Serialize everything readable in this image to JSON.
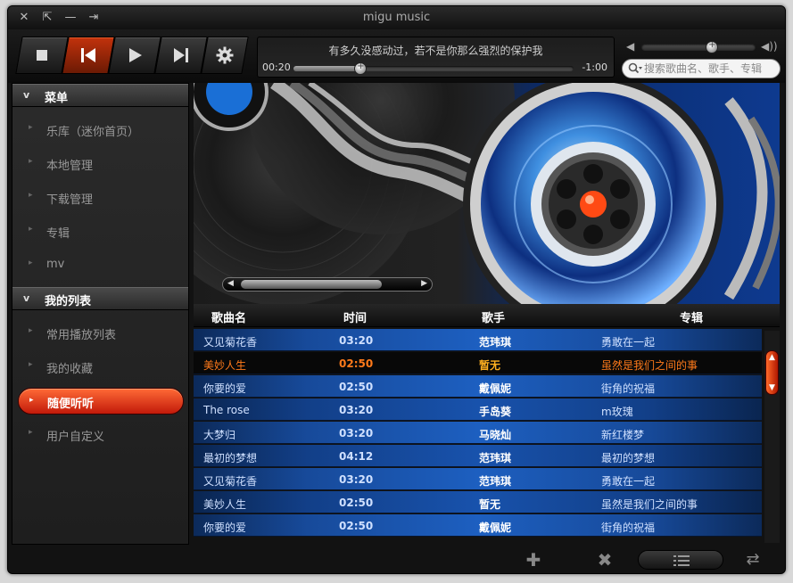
{
  "window": {
    "title": "migu music"
  },
  "player": {
    "now_playing": "有多久没感动过，若不是你那么强烈的保护我",
    "current_time": "00:20",
    "remaining_time": "-1:00",
    "progress": 0.24,
    "volume": 0.62
  },
  "search": {
    "placeholder": "搜索歌曲名、歌手、专辑"
  },
  "sidebar": {
    "menu_header": "菜单",
    "menu_items": [
      {
        "label": "乐库（迷你首页）"
      },
      {
        "label": "本地管理"
      },
      {
        "label": "下载管理"
      },
      {
        "label": "专辑"
      },
      {
        "label": "mv"
      }
    ],
    "list_header": "我的列表",
    "list_items": [
      {
        "label": "常用播放列表"
      },
      {
        "label": "我的收藏"
      },
      {
        "label": "随便听听",
        "active": true
      },
      {
        "label": "用户自定义"
      }
    ]
  },
  "table": {
    "headers": {
      "title": "歌曲名",
      "time": "时间",
      "artist": "歌手",
      "album": "专辑"
    },
    "rows": [
      {
        "title": "又见菊花香",
        "time": "03:20",
        "artist": "范玮琪",
        "album": "勇敢在一起"
      },
      {
        "title": "美妙人生",
        "time": "02:50",
        "artist": "暂无",
        "album": "虽然是我们之间的事",
        "playing": true
      },
      {
        "title": "你要的爱",
        "time": "02:50",
        "artist": "戴佩妮",
        "album": "街角的祝福"
      },
      {
        "title": "The rose",
        "time": "03:20",
        "artist": "手岛葵",
        "album": "m玫瑰"
      },
      {
        "title": "大梦归",
        "time": "03:20",
        "artist": "马晓灿",
        "album": "新红楼梦"
      },
      {
        "title": "最初的梦想",
        "time": "04:12",
        "artist": "范玮琪",
        "album": "最初的梦想"
      },
      {
        "title": "又见菊花香",
        "time": "03:20",
        "artist": "范玮琪",
        "album": "勇敢在一起"
      },
      {
        "title": "美妙人生",
        "time": "02:50",
        "artist": "暂无",
        "album": "虽然是我们之间的事"
      },
      {
        "title": "你要的爱",
        "time": "02:50",
        "artist": "戴佩妮",
        "album": "街角的祝福"
      }
    ]
  },
  "icons": {
    "window_controls": [
      "close-icon",
      "restore-icon",
      "minimize-icon",
      "mini-mode-icon"
    ],
    "toolbar": [
      "stop-icon",
      "previous-icon",
      "play-icon",
      "next-icon",
      "settings-icon"
    ],
    "bottom": [
      "add-icon",
      "delete-icon",
      "list-icon",
      "repeat-icon"
    ]
  },
  "colors": {
    "accent": "#e0451a",
    "row_blue": "#1d5fc0",
    "playing_text": "#ff7a1a"
  }
}
